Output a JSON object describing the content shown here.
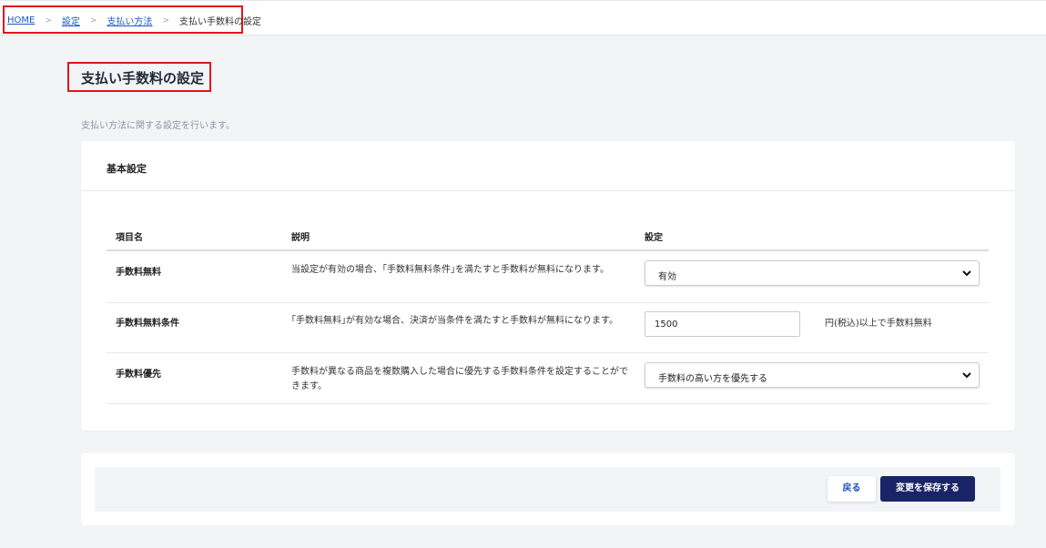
{
  "breadcrumb": {
    "items": [
      "HOME",
      "設定",
      "支払い方法"
    ],
    "separator": ">",
    "current": "支払い手数料の設定"
  },
  "page": {
    "title": "支払い手数料の設定",
    "description": "支払い方法に関する設定を行います。"
  },
  "card": {
    "title": "基本設定",
    "columns": [
      "項目名",
      "説明",
      "設定"
    ],
    "rows": [
      {
        "name": "手数料無料",
        "description": "当設定が有効の場合、｢手数料無料条件｣を満たすと手数料が無料になります。",
        "value": "有効"
      },
      {
        "name": "手数料無料条件",
        "description": "｢手数料無料｣が有効な場合、決済が当条件を満たすと手数料が無料になります。",
        "value": "1500",
        "suffix": "円(税込)以上で手数料無料"
      },
      {
        "name": "手数料優先",
        "description": "手数料が異なる商品を複数購入した場合に優先する手数料条件を設定することができます。",
        "value": "手数料の高い方を優先する"
      }
    ]
  },
  "footer": {
    "back_label": "戻る",
    "save_label": "変更を保存する"
  },
  "colors": {
    "highlight_border": "#e0141d",
    "link": "#1d57c8",
    "primary_button": "#1a2567"
  },
  "icons": [
    "chevron-down-icon"
  ]
}
